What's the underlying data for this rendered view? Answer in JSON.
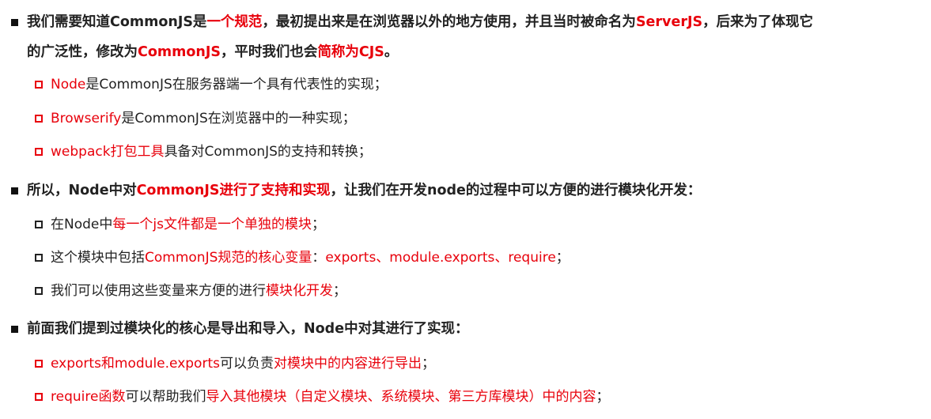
{
  "colors": {
    "accent": "#e8000b",
    "text": "#222222"
  },
  "sections": [
    {
      "heading_line1": [
        {
          "t": "我们需要知道CommonJS是",
          "hl": false
        },
        {
          "t": "一个规范",
          "hl": true
        },
        {
          "t": "，最初提出来是在浏览器以外的地方使用，并且当时被命名为",
          "hl": false
        },
        {
          "t": "ServerJS",
          "hl": true
        },
        {
          "t": "，后来为了体现它",
          "hl": false
        }
      ],
      "heading_line2": [
        {
          "t": "的广泛性，修改为",
          "hl": false
        },
        {
          "t": "CommonJS",
          "hl": true
        },
        {
          "t": "，平时我们也会",
          "hl": false
        },
        {
          "t": "简称为CJS",
          "hl": true
        },
        {
          "t": "。",
          "hl": false
        }
      ],
      "items": [
        [
          {
            "t": "Node",
            "hl": true
          },
          {
            "t": "是CommonJS在服务器端一个具有代表性的实现；",
            "hl": false
          }
        ],
        [
          {
            "t": "Browserify",
            "hl": true
          },
          {
            "t": "是CommonJS在浏览器中的一种实现；",
            "hl": false
          }
        ],
        [
          {
            "t": "webpack打包工具",
            "hl": true
          },
          {
            "t": "具备对CommonJS的支持和转换；",
            "hl": false
          }
        ]
      ]
    },
    {
      "heading_line1": [
        {
          "t": "所以，Node中对",
          "hl": false
        },
        {
          "t": "CommonJS进行了支持和实现",
          "hl": true
        },
        {
          "t": "，让我们在开发node的过程中可以方便的进行模块化开发：",
          "hl": false
        }
      ],
      "items": [
        [
          {
            "t": "在Node中",
            "hl": false
          },
          {
            "t": "每一个js文件都是一个单独的模块",
            "hl": true
          },
          {
            "t": "；",
            "hl": false
          }
        ],
        [
          {
            "t": "这个模块中包括",
            "hl": false
          },
          {
            "t": "CommonJS规范的核心变量",
            "hl": true
          },
          {
            "t": "：",
            "hl": false
          },
          {
            "t": "exports、module.exports、require",
            "hl": true
          },
          {
            "t": "；",
            "hl": false
          }
        ],
        [
          {
            "t": "我们可以使用这些变量来方便的进行",
            "hl": false
          },
          {
            "t": "模块化开发",
            "hl": true
          },
          {
            "t": "；",
            "hl": false
          }
        ]
      ]
    },
    {
      "heading_line1": [
        {
          "t": "前面我们提到过模块化的核心是导出和导入，Node中对其进行了实现：",
          "hl": false
        }
      ],
      "items": [
        [
          {
            "t": "exports和module.exports",
            "hl": true
          },
          {
            "t": "可以负责",
            "hl": false
          },
          {
            "t": "对模块中的内容进行导出",
            "hl": true
          },
          {
            "t": "；",
            "hl": false
          }
        ],
        [
          {
            "t": "require函数",
            "hl": true
          },
          {
            "t": "可以帮助我们",
            "hl": false
          },
          {
            "t": "导入其他模块（自定义模块、系统模块、第三方库模块）中的内容",
            "hl": true
          },
          {
            "t": "；",
            "hl": false
          }
        ]
      ]
    }
  ]
}
